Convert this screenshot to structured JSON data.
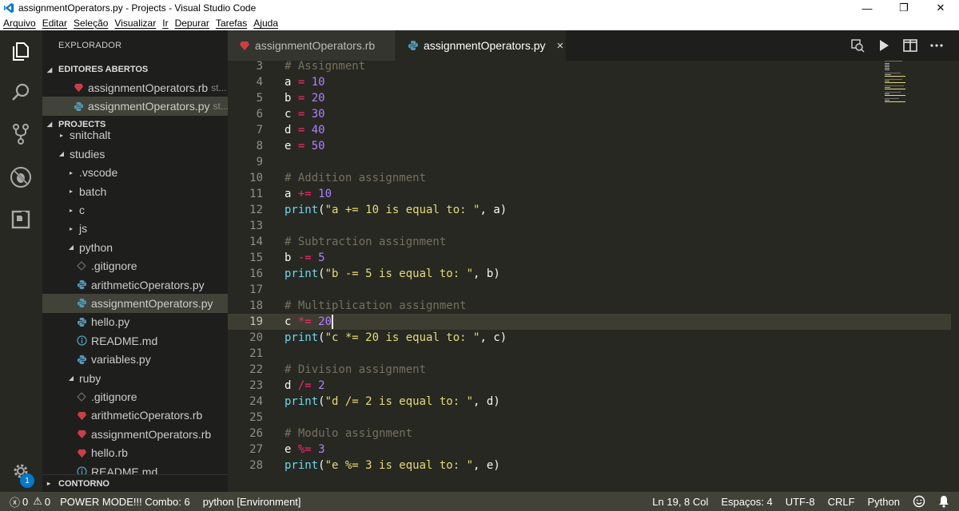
{
  "window": {
    "title": "assignmentOperators.py - Projects - Visual Studio Code"
  },
  "menu": [
    "Arquivo",
    "Editar",
    "Seleção",
    "Visualizar",
    "Ir",
    "Depurar",
    "Tarefas",
    "Ajuda"
  ],
  "sidebar": {
    "title": "EXPLORADOR",
    "open_editors": {
      "label": "EDITORES ABERTOS",
      "items": [
        {
          "name": "assignmentOperators.rb",
          "hint": "st...",
          "icon": "ruby-icon",
          "selected": false
        },
        {
          "name": "assignmentOperators.py",
          "hint": "st...",
          "icon": "python-icon",
          "selected": true
        }
      ]
    },
    "projects": {
      "label": "PROJECTS",
      "items": [
        {
          "name": "snitchalt",
          "type": "folder",
          "expanded": false,
          "indent": 1
        },
        {
          "name": "studies",
          "type": "folder",
          "expanded": true,
          "indent": 1
        },
        {
          "name": ".vscode",
          "type": "folder",
          "expanded": false,
          "indent": 2
        },
        {
          "name": "batch",
          "type": "folder",
          "expanded": false,
          "indent": 2
        },
        {
          "name": "c",
          "type": "folder",
          "expanded": false,
          "indent": 2
        },
        {
          "name": "js",
          "type": "folder",
          "expanded": false,
          "indent": 2
        },
        {
          "name": "python",
          "type": "folder",
          "expanded": true,
          "indent": 2
        },
        {
          "name": ".gitignore",
          "type": "git",
          "indent": 3
        },
        {
          "name": "arithmeticOperators.py",
          "type": "python",
          "indent": 3
        },
        {
          "name": "assignmentOperators.py",
          "type": "python",
          "indent": 3,
          "selected": true
        },
        {
          "name": "hello.py",
          "type": "python",
          "indent": 3
        },
        {
          "name": "README.md",
          "type": "info",
          "indent": 3
        },
        {
          "name": "variables.py",
          "type": "python",
          "indent": 3
        },
        {
          "name": "ruby",
          "type": "folder",
          "expanded": true,
          "indent": 2
        },
        {
          "name": ".gitignore",
          "type": "git",
          "indent": 3
        },
        {
          "name": "arithmeticOperators.rb",
          "type": "ruby",
          "indent": 3
        },
        {
          "name": "assignmentOperators.rb",
          "type": "ruby",
          "indent": 3
        },
        {
          "name": "hello.rb",
          "type": "ruby",
          "indent": 3
        },
        {
          "name": "README.md",
          "type": "info",
          "indent": 3
        }
      ]
    },
    "outline_label": "CONTORNO"
  },
  "activity_badge": "1",
  "tabs": [
    {
      "label": "assignmentOperators.rb",
      "icon": "ruby-icon",
      "active": false
    },
    {
      "label": "assignmentOperators.py",
      "icon": "python-icon",
      "active": true,
      "close": "×"
    }
  ],
  "editor": {
    "current_line": 19,
    "lines": [
      {
        "n": "3",
        "tokens": [
          [
            "c",
            "# Assignment"
          ]
        ]
      },
      {
        "n": "4",
        "tokens": [
          [
            "p",
            "a "
          ],
          [
            "o",
            "="
          ],
          [
            "p",
            " "
          ],
          [
            "d",
            "10"
          ]
        ]
      },
      {
        "n": "5",
        "tokens": [
          [
            "p",
            "b "
          ],
          [
            "o",
            "="
          ],
          [
            "p",
            " "
          ],
          [
            "d",
            "20"
          ]
        ]
      },
      {
        "n": "6",
        "tokens": [
          [
            "p",
            "c "
          ],
          [
            "o",
            "="
          ],
          [
            "p",
            " "
          ],
          [
            "d",
            "30"
          ]
        ]
      },
      {
        "n": "7",
        "tokens": [
          [
            "p",
            "d "
          ],
          [
            "o",
            "="
          ],
          [
            "p",
            " "
          ],
          [
            "d",
            "40"
          ]
        ]
      },
      {
        "n": "8",
        "tokens": [
          [
            "p",
            "e "
          ],
          [
            "o",
            "="
          ],
          [
            "p",
            " "
          ],
          [
            "d",
            "50"
          ]
        ]
      },
      {
        "n": "9",
        "tokens": []
      },
      {
        "n": "10",
        "tokens": [
          [
            "c",
            "# Addition assignment"
          ]
        ]
      },
      {
        "n": "11",
        "tokens": [
          [
            "p",
            "a "
          ],
          [
            "o",
            "+="
          ],
          [
            "p",
            " "
          ],
          [
            "d",
            "10"
          ]
        ]
      },
      {
        "n": "12",
        "tokens": [
          [
            "f",
            "print"
          ],
          [
            "p",
            "("
          ],
          [
            "s",
            "\"a += 10 is equal to: \""
          ],
          [
            "p",
            ", a)"
          ]
        ]
      },
      {
        "n": "13",
        "tokens": []
      },
      {
        "n": "14",
        "tokens": [
          [
            "c",
            "# Subtraction assignment"
          ]
        ]
      },
      {
        "n": "15",
        "tokens": [
          [
            "p",
            "b "
          ],
          [
            "o",
            "-="
          ],
          [
            "p",
            " "
          ],
          [
            "d",
            "5"
          ]
        ]
      },
      {
        "n": "16",
        "tokens": [
          [
            "f",
            "print"
          ],
          [
            "p",
            "("
          ],
          [
            "s",
            "\"b -= 5 is equal to: \""
          ],
          [
            "p",
            ", b)"
          ]
        ]
      },
      {
        "n": "17",
        "tokens": []
      },
      {
        "n": "18",
        "tokens": [
          [
            "c",
            "# Multiplication assignment"
          ]
        ]
      },
      {
        "n": "19",
        "tokens": [
          [
            "p",
            "c "
          ],
          [
            "o",
            "*="
          ],
          [
            "p",
            " "
          ],
          [
            "d",
            "20"
          ]
        ]
      },
      {
        "n": "20",
        "tokens": [
          [
            "f",
            "print"
          ],
          [
            "p",
            "("
          ],
          [
            "s",
            "\"c *= 20 is equal to: \""
          ],
          [
            "p",
            ", c)"
          ]
        ]
      },
      {
        "n": "21",
        "tokens": []
      },
      {
        "n": "22",
        "tokens": [
          [
            "c",
            "# Division assignment"
          ]
        ]
      },
      {
        "n": "23",
        "tokens": [
          [
            "p",
            "d "
          ],
          [
            "o",
            "/="
          ],
          [
            "p",
            " "
          ],
          [
            "d",
            "2"
          ]
        ]
      },
      {
        "n": "24",
        "tokens": [
          [
            "f",
            "print"
          ],
          [
            "p",
            "("
          ],
          [
            "s",
            "\"d /= 2 is equal to: \""
          ],
          [
            "p",
            ", d)"
          ]
        ]
      },
      {
        "n": "25",
        "tokens": []
      },
      {
        "n": "26",
        "tokens": [
          [
            "c",
            "# Modulo assignment"
          ]
        ]
      },
      {
        "n": "27",
        "tokens": [
          [
            "p",
            "e "
          ],
          [
            "o",
            "%="
          ],
          [
            "p",
            " "
          ],
          [
            "d",
            "3"
          ]
        ]
      },
      {
        "n": "28",
        "tokens": [
          [
            "f",
            "print"
          ],
          [
            "p",
            "("
          ],
          [
            "s",
            "\"e %= 3 is equal to: \""
          ],
          [
            "p",
            ", e)"
          ]
        ]
      }
    ]
  },
  "statusbar": {
    "errors": "0",
    "warnings": "0",
    "power_mode": "POWER MODE!!! Combo: 6",
    "interpreter": "python [Environment]",
    "position": "Ln 19, 8 Col",
    "spaces": "Espaços: 4",
    "encoding": "UTF-8",
    "eol": "CRLF",
    "language": "Python"
  },
  "colors": {
    "background": "#272822",
    "sidebar": "#1e1f1c",
    "statusbar": "#414339",
    "comment": "#75715e",
    "operator": "#f92672",
    "number": "#ae81ff",
    "function": "#66d9ef",
    "string": "#e6db74",
    "python_icon": "#519aba",
    "ruby_icon": "#cc3e44"
  }
}
